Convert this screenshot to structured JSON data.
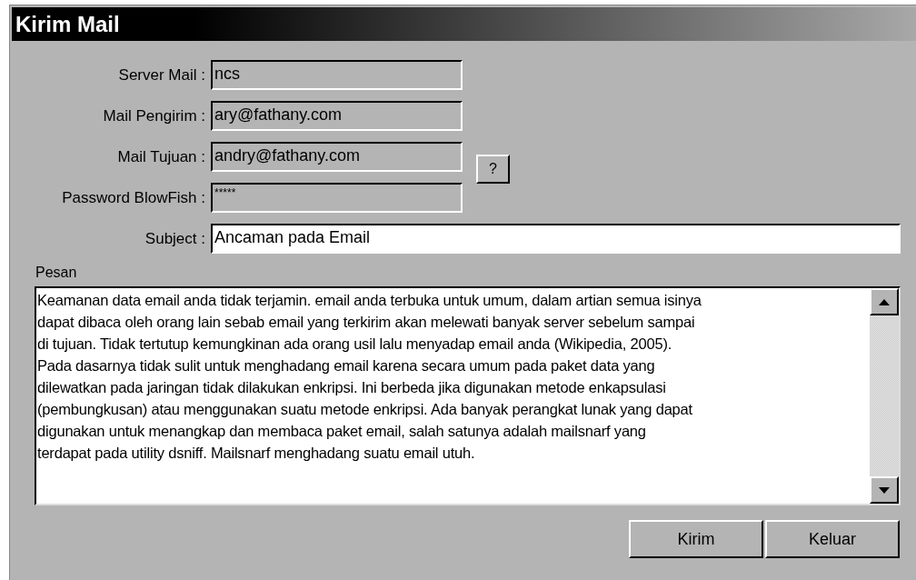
{
  "window": {
    "title": "Kirim Mail"
  },
  "fields": [
    {
      "label": "Server Mail :",
      "value": "ncs",
      "disabled": true
    },
    {
      "label": "Mail Pengirim :",
      "value": "ary@fathany.com",
      "disabled": true
    },
    {
      "label": "Mail Tujuan :",
      "value": "andry@fathany.com",
      "disabled": true,
      "help_button": "?"
    },
    {
      "label": "Password BlowFish :",
      "value": "*****",
      "disabled": true,
      "kind": "password"
    },
    {
      "label": "Subject :",
      "value": "Ancaman pada Email",
      "disabled": false,
      "kind": "wide"
    }
  ],
  "message": {
    "label": "Pesan",
    "lines": [
      "Keamanan data email anda tidak terjamin. email anda terbuka untuk umum, dalam artian semua isinya",
      "dapat dibaca oleh orang lain sebab email yang terkirim akan melewati banyak server sebelum sampai",
      "di tujuan. Tidak tertutup kemungkinan ada orang usil lalu menyadap email anda (Wikipedia, 2005).",
      "Pada dasarnya tidak sulit untuk menghadang email karena secara umum pada paket data yang",
      "dilewatkan pada jaringan tidak dilakukan enkripsi. Ini berbeda jika digunakan metode enkapsulasi",
      "(pembungkusan) atau menggunakan suatu metode enkripsi. Ada banyak perangkat lunak yang dapat",
      "digunakan untuk menangkap dan membaca paket email, salah satunya adalah mailsnarf yang",
      "terdapat pada utility dsniff. Mailsnarf menghadang suatu email utuh."
    ]
  },
  "buttons": [
    "Kirim",
    "Keluar"
  ]
}
